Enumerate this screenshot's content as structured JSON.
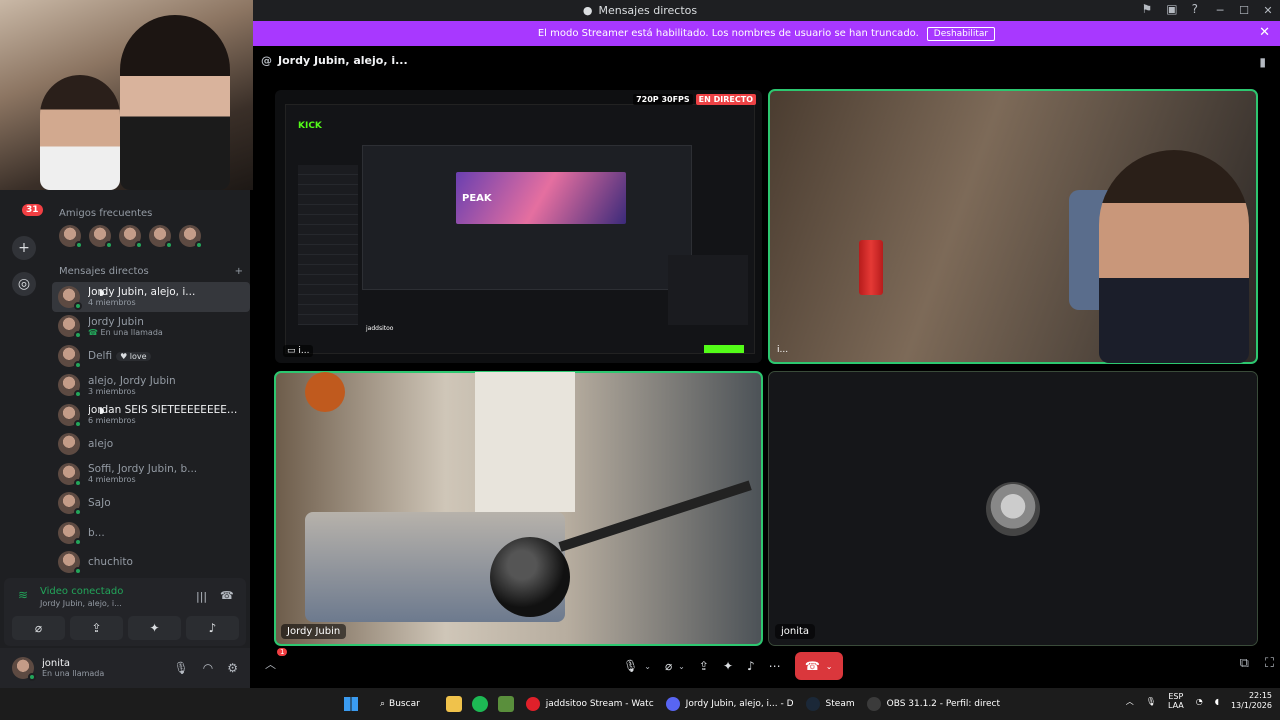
{
  "window": {
    "title": "Mensajes directos"
  },
  "banner": {
    "text": "El modo Streamer está habilitado. Los nombres de usuario se han truncado.",
    "button": "Deshabilitar"
  },
  "rail": {
    "badge": "31"
  },
  "sidebar": {
    "frequent_title": "Amigos frecuentes",
    "dm_title": "Mensajes directos",
    "dms": [
      {
        "name": "Jordy Jubin, alejo, i...",
        "sub": "4 miembros",
        "active": true
      },
      {
        "name": "Jordy Jubin",
        "sub": "En una llamada"
      },
      {
        "name": "Delfi",
        "tag": "love"
      },
      {
        "name": "alejo, Jordy Jubin",
        "sub": "3 miembros"
      },
      {
        "name": "jordan SEIS SIETEEEEEEEE, T...",
        "sub": "6 miembros",
        "bold": true
      },
      {
        "name": "alejo"
      },
      {
        "name": "Soffi, Jordy Jubin, b...",
        "sub": "4 miembros"
      },
      {
        "name": "SaJo"
      },
      {
        "name": "b..."
      },
      {
        "name": "chuchito"
      }
    ]
  },
  "voice": {
    "status": "Video conectado",
    "channel": "Jordy Jubin, alejo, i..."
  },
  "user": {
    "name": "jonita",
    "status": "En una llamada"
  },
  "call": {
    "header": "Jordy Jubin, alejo, i...",
    "screen_badges": {
      "quality": "720P 30FPS",
      "live": "EN DIRECTO"
    },
    "screen_owner": "i...",
    "cam2_name": "i...",
    "cam3_name": "Jordy Jubin",
    "empty_name": "jonita",
    "kick": {
      "logo": "KICK",
      "stream_title": "PEAK",
      "streamer": "jaddsitoo"
    },
    "notif_count": "1"
  },
  "taskbar": {
    "search": "Buscar",
    "tasks": [
      {
        "label": "jaddsitoo Stream - Watc",
        "color": "#e0202a"
      },
      {
        "label": "Jordy Jubin, alejo, i... - D",
        "color": "#5865f2"
      },
      {
        "label": "Steam",
        "color": "#1b2838"
      },
      {
        "label": "OBS 31.1.2 - Perfil: direct",
        "color": "#3b3b3b"
      }
    ],
    "lang1": "ESP",
    "lang2": "LAA",
    "time": "22:15",
    "date": "13/1/2026"
  }
}
